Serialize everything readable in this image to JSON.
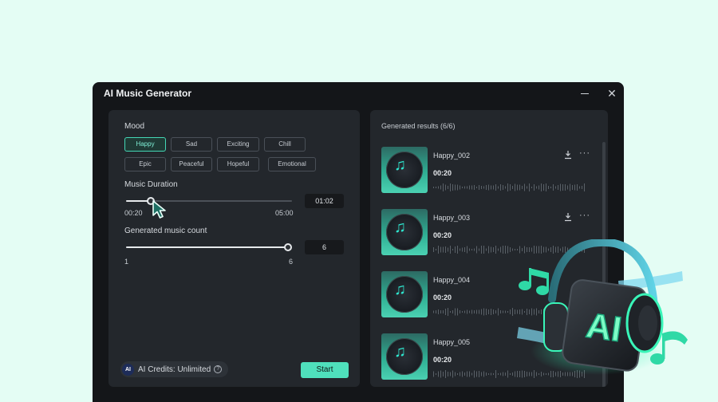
{
  "window": {
    "title": "AI Music Generator"
  },
  "mood": {
    "label": "Mood",
    "chips": [
      "Happy",
      "Sad",
      "Exciting",
      "Chill",
      "Epic",
      "Peaceful",
      "Hopeful",
      "Emotional"
    ],
    "selected": "Happy"
  },
  "duration": {
    "label": "Music Duration",
    "min": "00:20",
    "max": "05:00",
    "value": "01:02",
    "fraction": 0.15
  },
  "count": {
    "label": "Generated music count",
    "min": "1",
    "max": "6",
    "value": "6",
    "fraction": 1.0
  },
  "credits": {
    "badge": "AI",
    "text": "AI Credits: Unlimited",
    "help": "?"
  },
  "start_label": "Start",
  "results": {
    "title": "Generated results (6/6)",
    "items": [
      {
        "name": "Happy_002",
        "time": "00:20"
      },
      {
        "name": "Happy_003",
        "time": "00:20"
      },
      {
        "name": "Happy_004",
        "time": "00:20"
      },
      {
        "name": "Happy_005",
        "time": "00:20"
      }
    ]
  },
  "icons": {
    "minimize": "minimize-icon",
    "close": "close-icon",
    "download": "download-icon",
    "more": "more-icon",
    "note": "music-note-icon"
  },
  "colors": {
    "accent": "#4fe0bc",
    "window_bg": "#141619",
    "panel_bg": "#23272c",
    "page_bg": "#e4fdf4"
  },
  "illustration": {
    "label": "AI"
  }
}
